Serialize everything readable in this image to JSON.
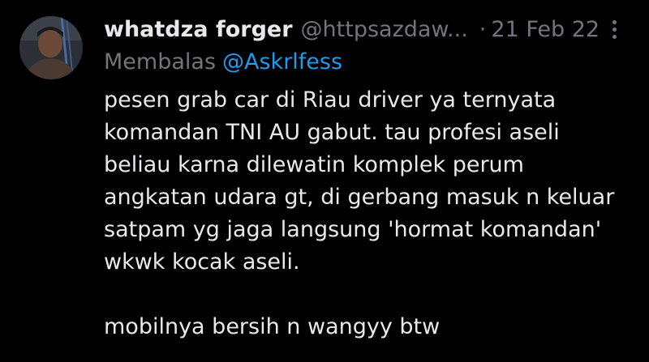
{
  "tweet": {
    "author": {
      "display_name": "whatdza forger",
      "handle": "@httpsazdaw...",
      "avatar_icon": "user-avatar-photo"
    },
    "separator": "·",
    "date": "21 Feb 22",
    "more_icon": "vertical-ellipsis-icon",
    "reply": {
      "label": "Membalas",
      "target": "@Askrlfess"
    },
    "body_lines": [
      "pesen grab car di Riau driver ya ternyata",
      "komandan TNI AU gabut. tau profesi aseli",
      "beliau karna dilewatin komplek perum",
      "angkatan udara gt, di gerbang masuk n keluar",
      "satpam yg jaga langsung 'hormat komandan'",
      "wkwk kocak aseli.",
      "mobilnya bersih n wangyy btw"
    ]
  },
  "colors": {
    "background": "#000000",
    "primary_text": "#e7e9ea",
    "secondary_text": "#71767b",
    "link": "#1d9bf0"
  }
}
